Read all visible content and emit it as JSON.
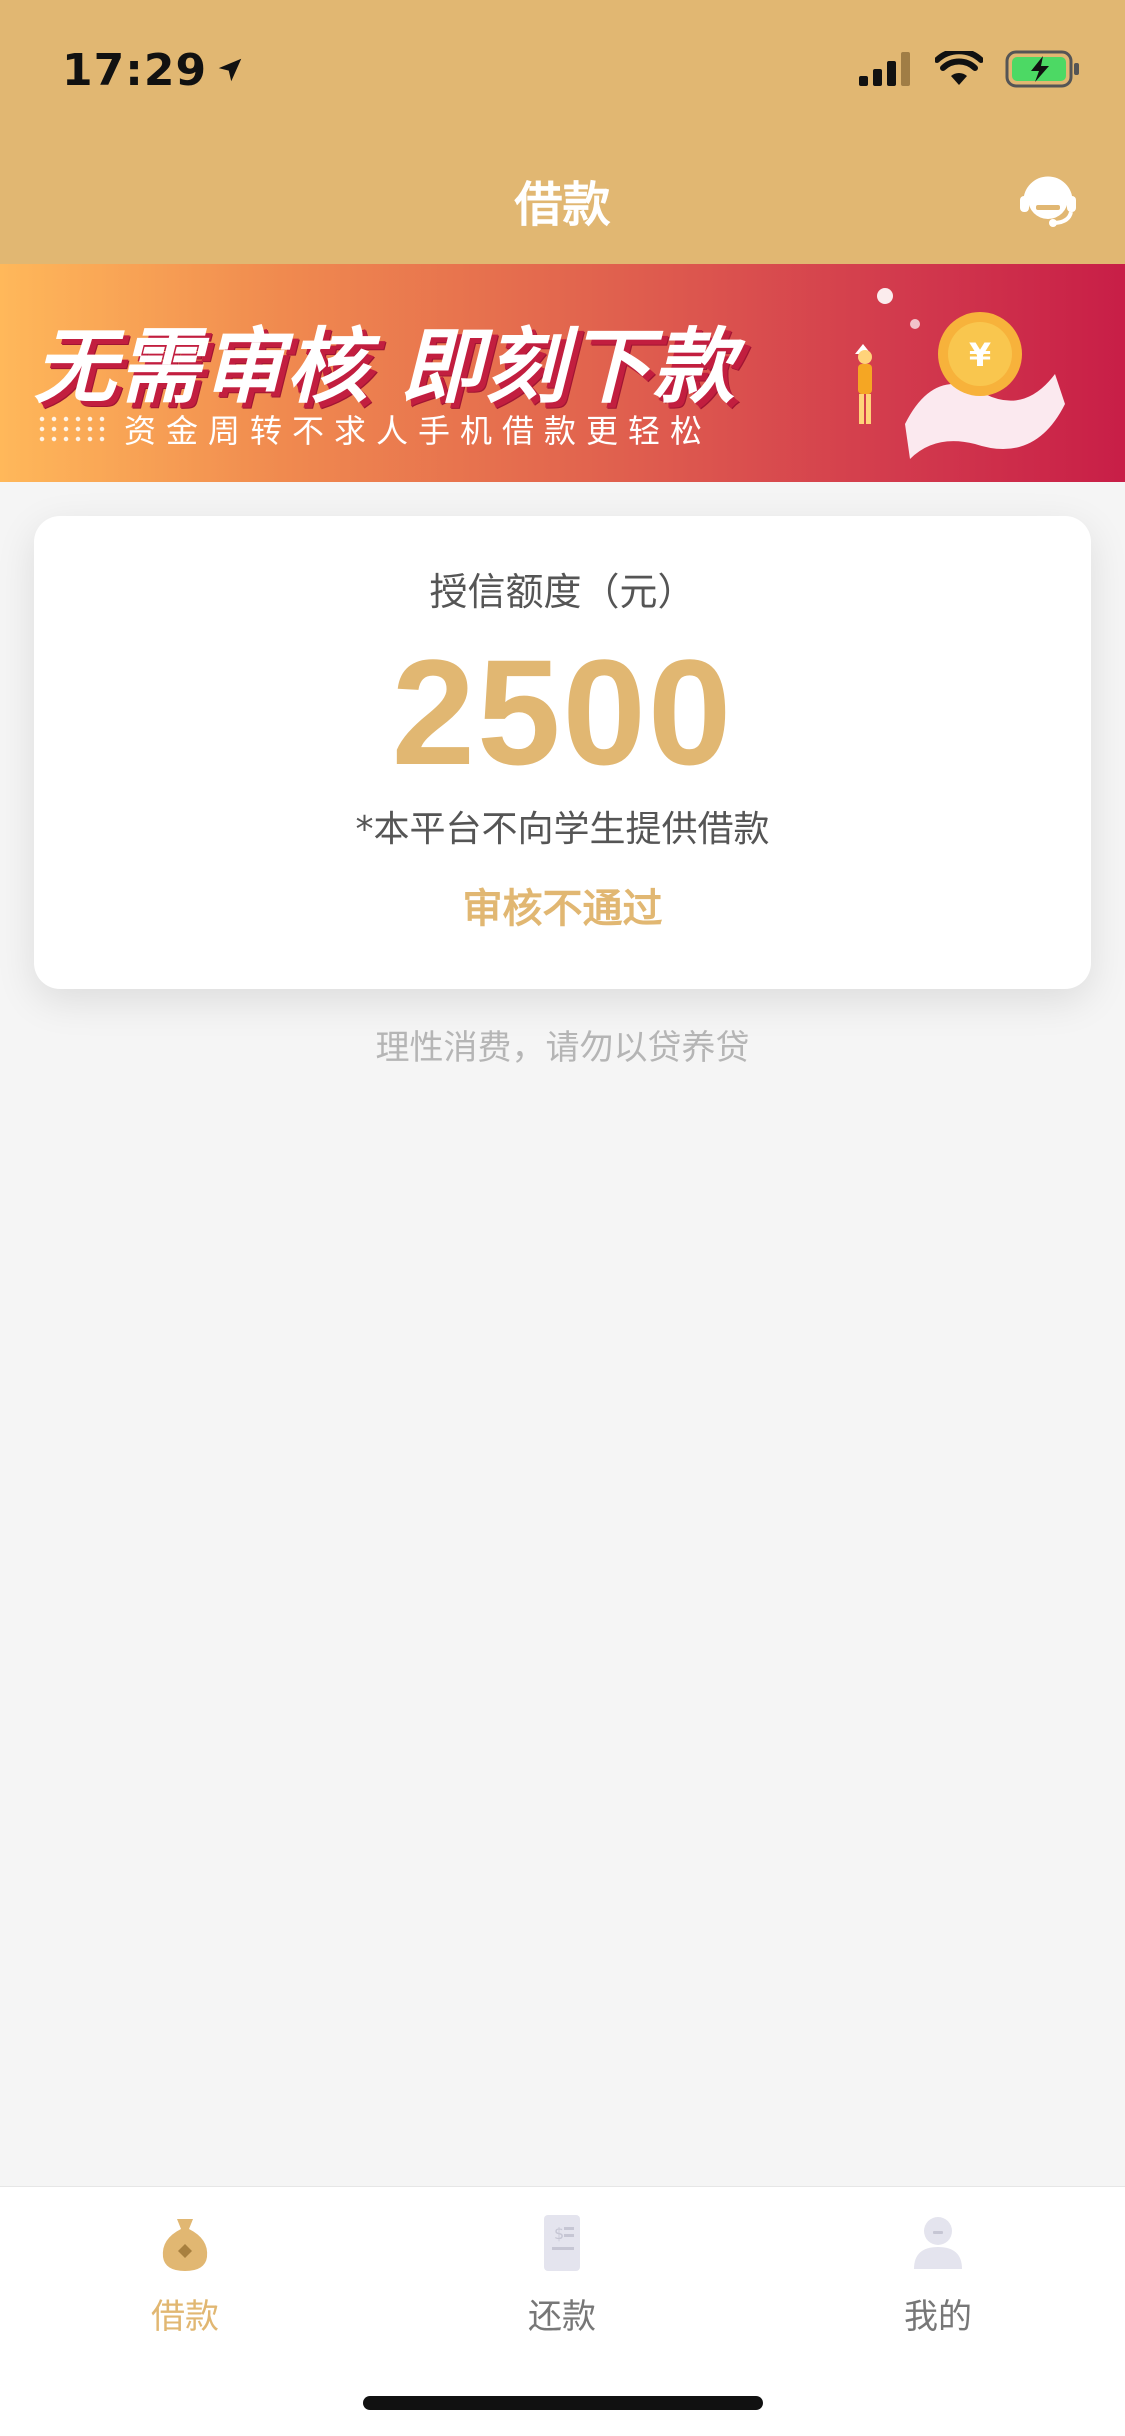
{
  "status_bar": {
    "time": "17:29",
    "icons": [
      "location-arrow-icon",
      "signal-icon",
      "wifi-icon",
      "battery-charging-icon"
    ]
  },
  "header": {
    "title": "借款",
    "service_icon": "headset-icon"
  },
  "banner": {
    "headline": "无需审核 即刻下款",
    "subtext": "资金周转不求人手机借款更轻松"
  },
  "credit_card": {
    "label": "授信额度（元）",
    "amount": "2500",
    "note": "*本平台不向学生提供借款",
    "status": "审核不通过"
  },
  "tip": "理性消费，请勿以贷养贷",
  "tabbar": {
    "items": [
      {
        "label": "借款",
        "icon": "money-bag-icon",
        "active": true
      },
      {
        "label": "还款",
        "icon": "bill-icon",
        "active": false
      },
      {
        "label": "我的",
        "icon": "user-icon",
        "active": false
      }
    ]
  },
  "colors": {
    "brand": "#e1b772",
    "background": "#f5f5f5",
    "banner_start": "#ffb85a",
    "banner_end": "#c81e47"
  }
}
